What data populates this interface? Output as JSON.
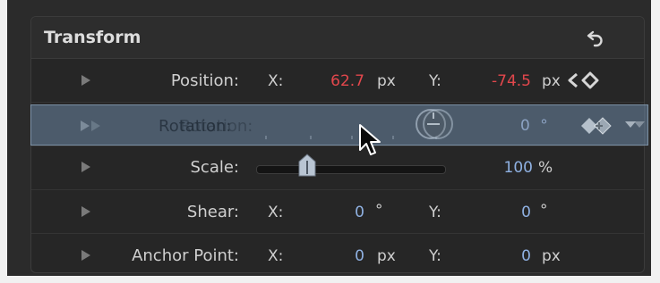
{
  "panel": {
    "title": "Transform",
    "reset_icon": "reset-arrow-icon"
  },
  "rows": {
    "position": {
      "label": "Position:",
      "x_label": "X:",
      "x_value": "62.7",
      "x_unit": "px",
      "y_label": "Y:",
      "y_value": "-74.5",
      "y_unit": "px",
      "keyframe_icon": "keyframe-nav-icon"
    },
    "scale": {
      "label": "Scale:",
      "value": "100",
      "unit": "%",
      "slider_percent": 27
    },
    "shear": {
      "label": "Shear:",
      "x_label": "X:",
      "x_value": "0",
      "x_unit": "°",
      "y_label": "Y:",
      "y_value": "0",
      "y_unit": "°"
    },
    "anchor": {
      "label": "Anchor Point:",
      "x_label": "X:",
      "x_value": "0",
      "x_unit": "px",
      "y_label": "Y:",
      "y_value": "0",
      "y_unit": "px"
    }
  },
  "drag_ghost": {
    "label": "Rotation:",
    "value": "0",
    "unit": "°",
    "dial_icon": "rotation-dial-icon",
    "keyframe_icon": "keyframe-diamond-icon",
    "menu_icon": "dropdown-arrow-icon"
  },
  "colors": {
    "red_value": "#e2474c",
    "blue_value": "#8fb1e2"
  },
  "cursor_icon": "mouse-pointer-icon"
}
